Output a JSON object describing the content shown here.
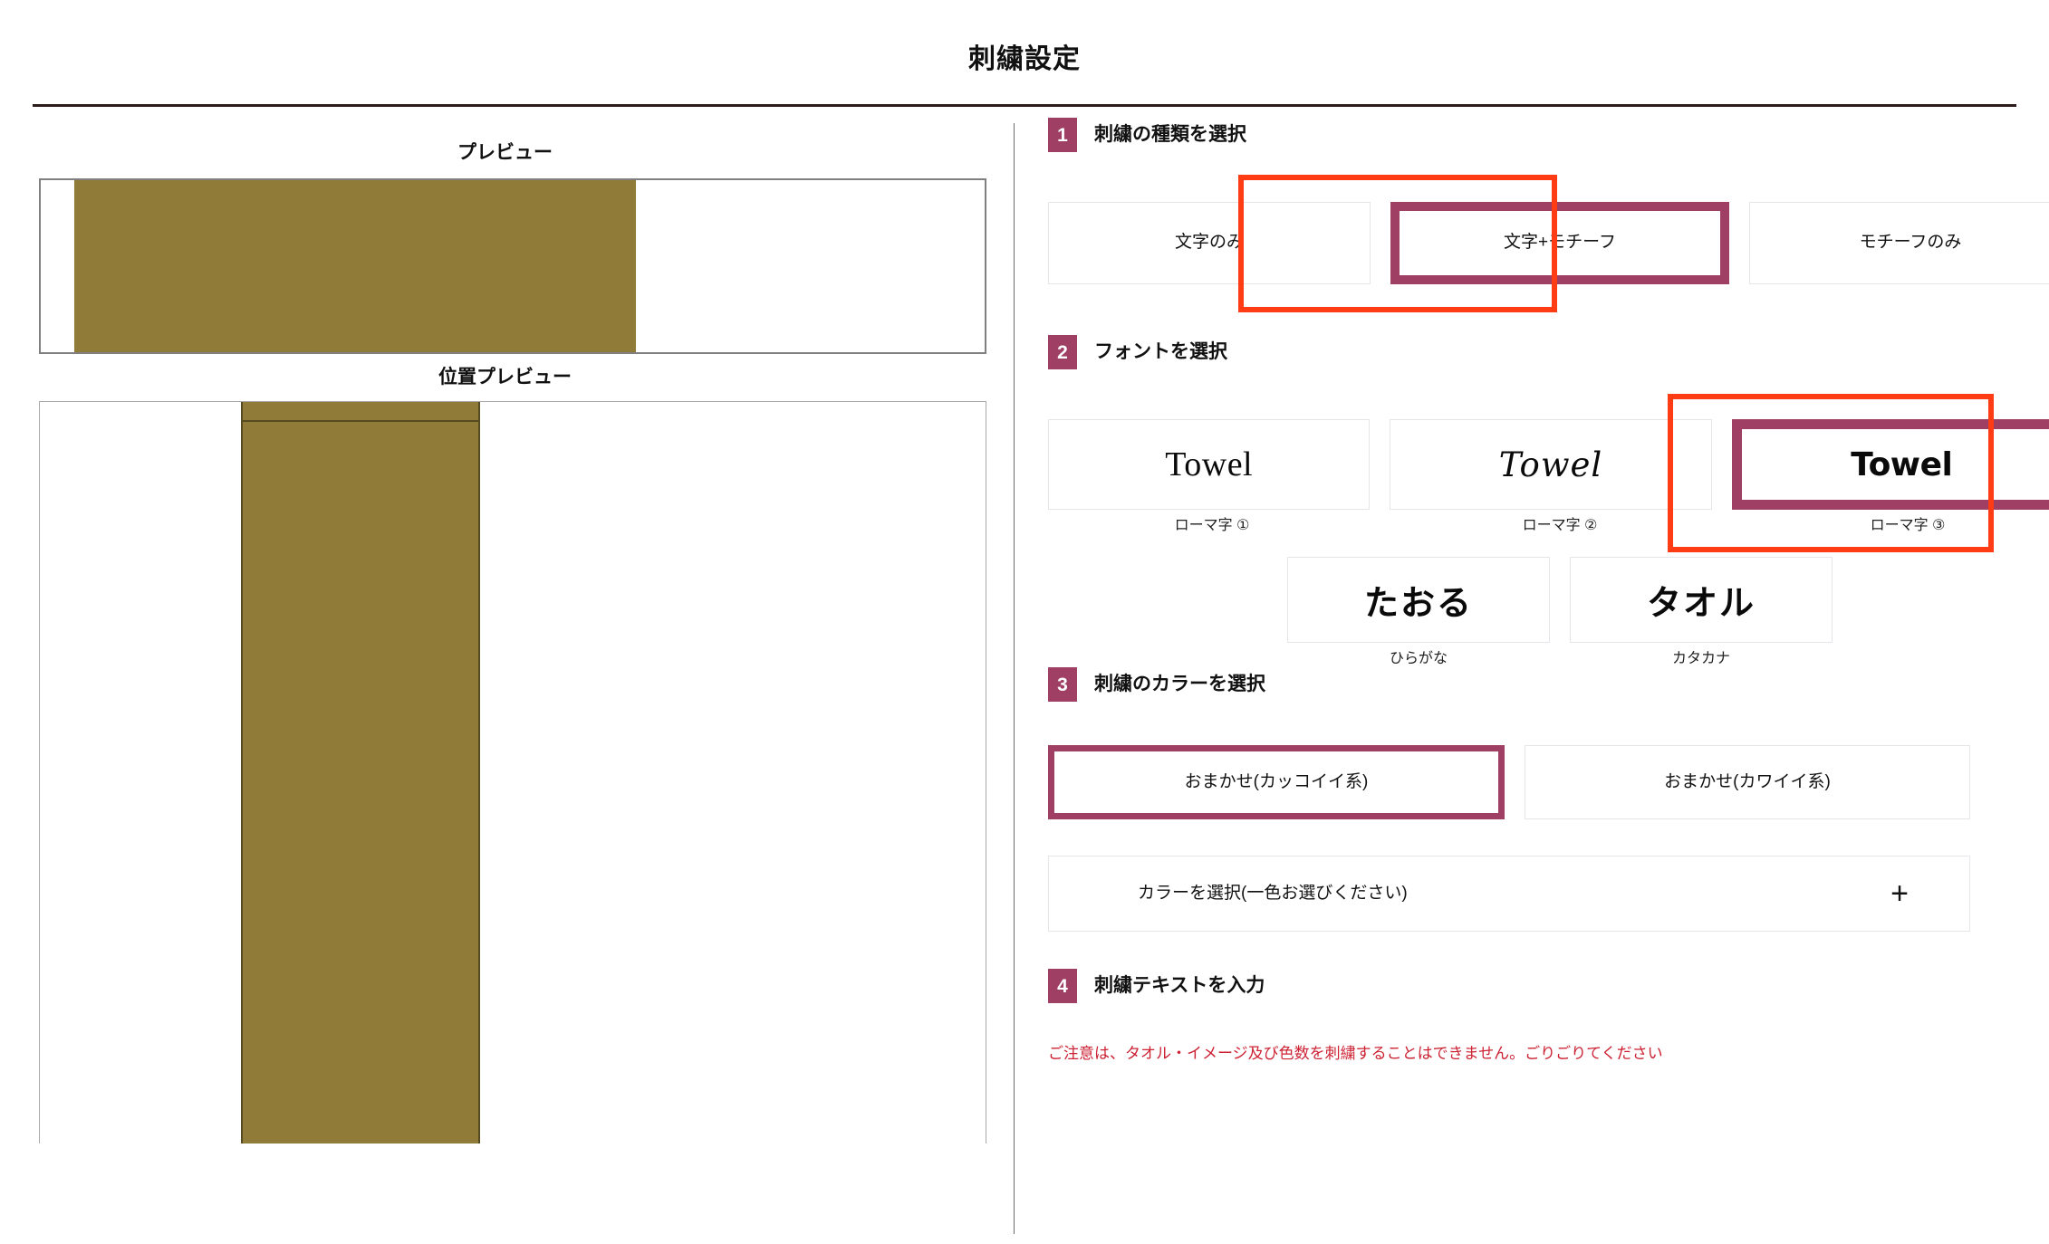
{
  "header": {
    "title": "刺繍設定"
  },
  "preview": {
    "preview_label": "プレビュー",
    "position_label": "位置プレビュー",
    "swatch_color": "#917b38",
    "towel_outline_color": "#564a21"
  },
  "theme": {
    "accent": "#9e3f63",
    "annotation_red": "#ff3c14",
    "rule": "#2b1b1b",
    "card_border": "#e4e6ea"
  },
  "steps": [
    {
      "number": "1",
      "title": "刺繍の種類を選択",
      "options": [
        {
          "label": "文字のみ",
          "selected": false,
          "annotated": false
        },
        {
          "label": "文字+モチーフ",
          "selected": true,
          "annotated": true
        },
        {
          "label": "モチーフのみ",
          "selected": false,
          "annotated": false
        }
      ]
    },
    {
      "number": "2",
      "title": "フォントを選択",
      "fonts_row1": [
        {
          "sample": "Towel",
          "caption": "ローマ字 ①",
          "selected": false,
          "annotated": false
        },
        {
          "sample": "Towel",
          "caption": "ローマ字 ②",
          "selected": false,
          "annotated": false
        },
        {
          "sample": "Towel",
          "caption": "ローマ字 ③",
          "selected": true,
          "annotated": true
        }
      ],
      "fonts_row2": [
        {
          "sample": "たおる",
          "caption": "ひらがな",
          "selected": false,
          "annotated": false
        },
        {
          "sample": "タオル",
          "caption": "カタカナ",
          "selected": false,
          "annotated": false
        }
      ]
    },
    {
      "number": "3",
      "title": "刺繍のカラーを選択",
      "options": [
        {
          "label": "おまかせ(カッコイイ系)",
          "selected": true,
          "annotated": false
        },
        {
          "label": "おまかせ(カワイイ系)",
          "selected": false,
          "annotated": false
        }
      ],
      "color_picker": {
        "label": "カラーを選択(一色お選びください)",
        "icon": "plus-icon",
        "icon_glyph": "+"
      }
    },
    {
      "number": "4",
      "title": "刺繍テキストを入力",
      "note": "ご注意は、タオル・イメージ及び色数を刺繍することはできません。ごりごりてください"
    }
  ]
}
